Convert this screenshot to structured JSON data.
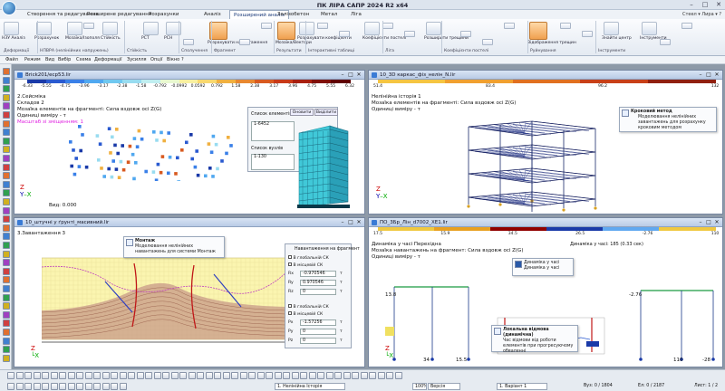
{
  "app": {
    "title": "ПК ЛІРА САПР 2024 R2 х64",
    "user": "Стеел ▾  Лира ▾  ?"
  },
  "tabs": [
    "Створення та редагування",
    "Розширене редагування",
    "Розрахунки",
    "Аналіз",
    "Розширений аналіз",
    "Залізобетон",
    "Метал",
    "Ліга"
  ],
  "active_tab": 4,
  "ribbon": {
    "buttons": [
      "НЗУ Аналіз",
      "Розрахунок",
      "Мозаїка/Ізополя",
      "Стійкість",
      "РСТ",
      "РСН",
      "Розрахувати навантаження",
      "Мозаїка/Вектори",
      "Розрахувати коефіцієнти",
      "Коефіцієнти постелі",
      "Розширити трещини",
      "Відображення трещин",
      "Знайти центр",
      "Інструменти"
    ],
    "groups": [
      "Деформації",
      "НПВРА (нелінійних напружень)",
      "Стійкість",
      "Сполучення",
      "Фрагмент",
      "Результати",
      "Інтерактивні таблиці",
      "Ліга",
      "Коефіцієнти постелі",
      "Руйнування",
      "Інструменти"
    ]
  },
  "menu": [
    "Файл",
    "Режим",
    "Вид",
    "Вибір",
    "Схема",
    "Деформації",
    "Зусилля",
    "Опції",
    "Вікно",
    "?"
  ],
  "windows": {
    "w1": {
      "title": "Brick201/ecp53.lir",
      "scale_ticks": [
        "-6.33",
        "-5.55",
        "-4.75",
        "-3.96",
        "-3.17",
        "-2.38",
        "-1.58",
        "-0.792",
        "-0.0992",
        "0.0592",
        "0.792",
        "1.58",
        "2.38",
        "3.17",
        "3.96",
        "4.75",
        "5.55",
        "6.32"
      ],
      "lines": [
        "2.Сейсміка",
        "Складов 2",
        "Мозаїка елементів на фрагменті: Сила вздовж осі Z(G)",
        "Одиниці виміру - т"
      ],
      "highlight": "Масштаб зі зміщенням: 1",
      "panel": {
        "list_title": "Список елементів",
        "btn1": "Оновити",
        "btn2": "Виділити",
        "value1": "1-6452",
        "list2_title": "Список вузлів",
        "value2": "1-130"
      },
      "axis_note": "Вид: 0.000"
    },
    "w2": {
      "title": "10_3D каркас_фіз_нелін_N.lir",
      "scale_ticks": [
        "51.4",
        "83.4",
        "96.2",
        "132"
      ],
      "lines": [
        "Нелінійна історія 1",
        "Мозаїка елементів на фрагменті: Сила вздовж осі Z(G)",
        "Одиниці виміру - т"
      ],
      "tip": {
        "title": "Кроковий метод",
        "body": "Моделювання нелінійних завантажень для розрахунку кроковим методом"
      }
    },
    "w3": {
      "title": "10_штучні у ґрунті_масивний.lir",
      "lines": [
        "3.Завантаження 3"
      ],
      "tip": {
        "title": "Монтаж",
        "body": "Моделювання нелінійних навантажень для системи Монтаж"
      },
      "panel": {
        "title": "Навантаження на фрагмент",
        "g1a": "В глобальній СК",
        "g1b": "В місцевій СК",
        "rx": "-0.970546",
        "ry": "0.970546",
        "rz": "0",
        "unit": "т",
        "g2a": "В глобальній СК",
        "g2b": "В місцевій СК",
        "px": "-1.57256",
        "py": "0",
        "pz": "0"
      }
    },
    "w4": {
      "title": "ПО_3Бр_Лін_d7002_XE1.lir",
      "scale_ticks": [
        "17.5",
        "15.9",
        "34.5",
        "26.5",
        "-2.76",
        "110"
      ],
      "lines": [
        "Динаміка у часі Перехідна",
        "Мозаїка навантажень на фрагмент: Сила вздовж осі Z(G)",
        "Одиниці виміру - т"
      ],
      "right_note": "Динаміка у часі: 185 (0.33 сек)",
      "tip_top": {
        "title": "Динаміка у часі",
        "body": "Динаміка у часі"
      },
      "tip_bottom": {
        "title": "Локальна відмова (динамічна)",
        "body": "Час відмови від роботи елементів при прогресуючому обваленні"
      },
      "labels": [
        "13.8",
        "34",
        "15.5",
        "-2.76",
        "110",
        "-28"
      ]
    }
  },
  "status": {
    "dd1": "1. Нелінійна Історія",
    "dd2": "Версія",
    "zoom": "100%",
    "dd3": "1. Варіант 1",
    "f1": "Вуз: 0 / 1804",
    "f2": "Ел: 0 / 2187",
    "f3": "Лист: 1 / 2"
  }
}
